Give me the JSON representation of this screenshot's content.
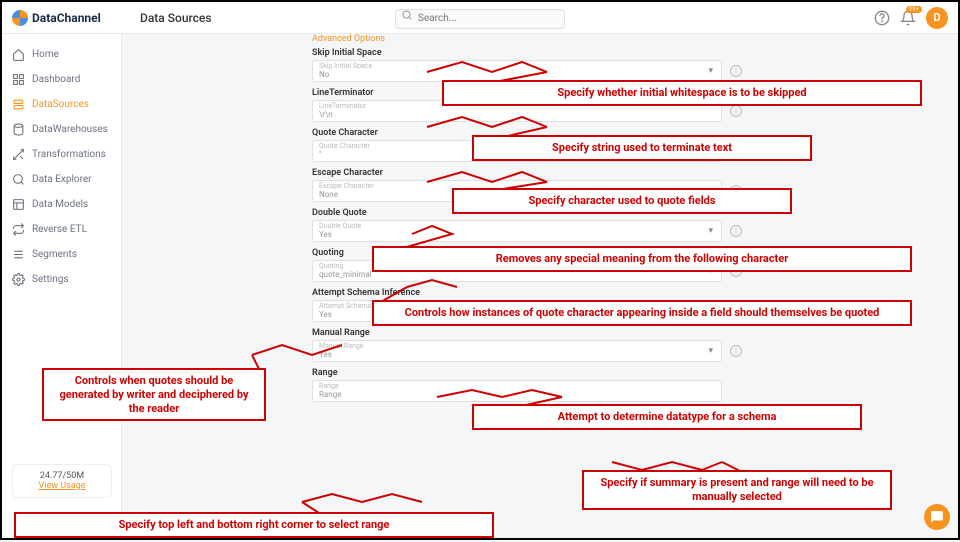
{
  "brand": "DataChannel",
  "page_title": "Data Sources",
  "search": {
    "placeholder": "Search..."
  },
  "avatar_letter": "D",
  "notif_count": "99+",
  "sidebar": {
    "items": [
      {
        "label": "Home"
      },
      {
        "label": "Dashboard"
      },
      {
        "label": "DataSources"
      },
      {
        "label": "DataWarehouses"
      },
      {
        "label": "Transformations"
      },
      {
        "label": "Data Explorer"
      },
      {
        "label": "Data Models"
      },
      {
        "label": "Reverse ETL"
      },
      {
        "label": "Segments"
      },
      {
        "label": "Settings"
      }
    ]
  },
  "usage": {
    "count": "24.77/50M",
    "link": "View Usage"
  },
  "advanced_options_label": "Advanced Options",
  "fields": {
    "skip_initial": {
      "label": "Skip Initial Space",
      "hint": "Skip Initial Space",
      "value": "No"
    },
    "line_term": {
      "label": "LineTerminator",
      "hint": "LineTerminator",
      "value": "\\r\\n"
    },
    "quote_char": {
      "label": "Quote Character",
      "hint": "Quote Character",
      "value": "\""
    },
    "escape_char": {
      "label": "Escape Character",
      "hint": "Escape Character",
      "value": "None"
    },
    "double_quote": {
      "label": "Double Quote",
      "hint": "Double Quote",
      "value": "Yes"
    },
    "quoting": {
      "label": "Quoting",
      "hint": "Quoting",
      "value": "quote_minimal"
    },
    "schema_inf": {
      "label": "Attempt Schema Inference",
      "hint": "Attempt Schema Inference",
      "value": "Yes"
    },
    "manual_range": {
      "label": "Manual Range",
      "hint": "Manual Range",
      "value": "Yes"
    },
    "range": {
      "label": "Range",
      "hint": "Range",
      "value": "Range"
    }
  },
  "annotations": {
    "a1": "Specify whether initial whitespace is to be skipped",
    "a2": "Specify string used to terminate text",
    "a3": "Specify character used to quote fields",
    "a4": "Removes any special meaning from the following character",
    "a5": "Controls how instances of quote character appearing inside a field should themselves be quoted",
    "a6": "Controls when quotes should be generated by writer and deciphered by the reader",
    "a7": "Attempt to determine datatype for a schema",
    "a8": "Specify if summary is present and range will need to be manually selected",
    "a9": "Specify top left and bottom right corner to select range"
  }
}
